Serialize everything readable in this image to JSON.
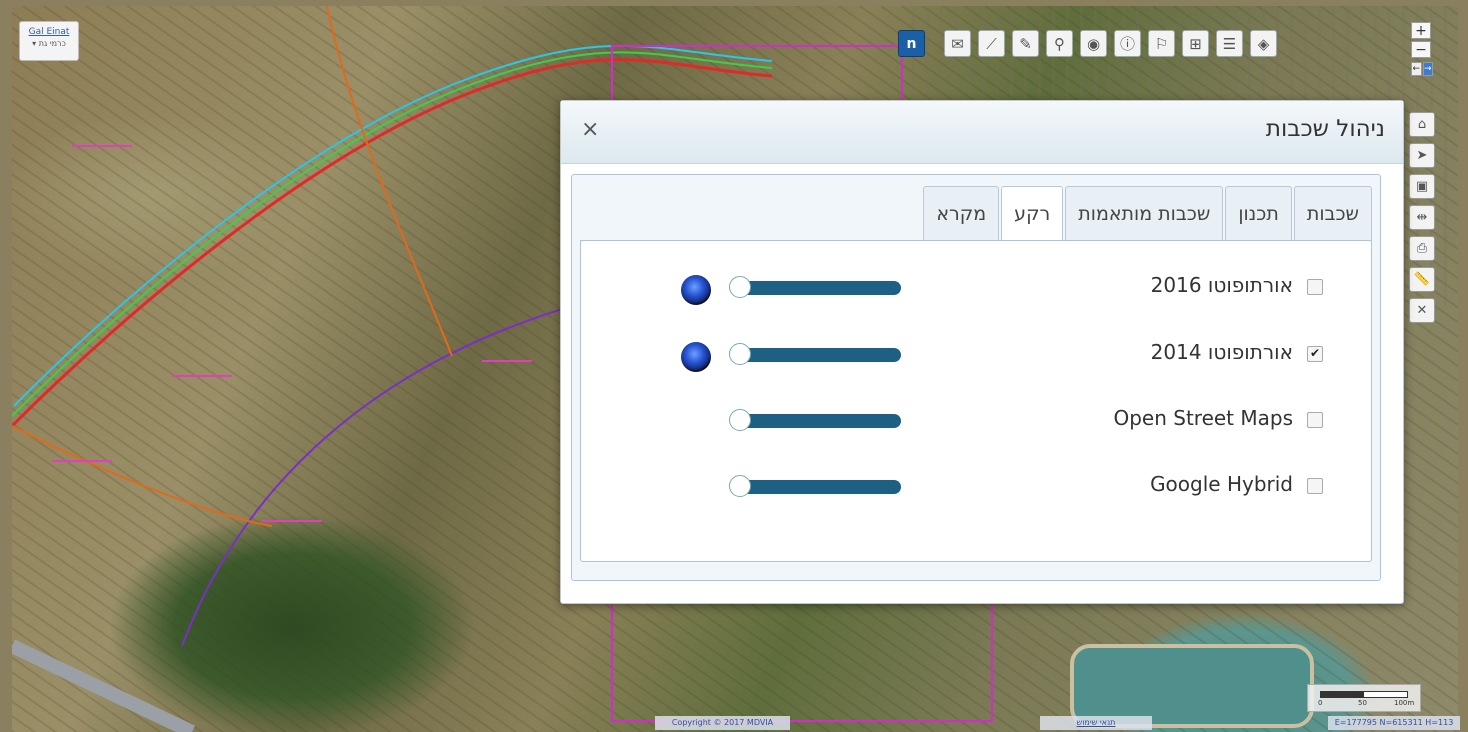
{
  "user": {
    "name": "Gal Einat",
    "menu": "▾ כרמי גת"
  },
  "toolbar": {
    "logo_label": "n",
    "icons": [
      "mail-icon",
      "chart-icon",
      "pencil-icon",
      "search-icon",
      "location-pin-icon",
      "info-icon",
      "flag-icon",
      "sitemap-icon",
      "database-icon",
      "layers-icon"
    ]
  },
  "zoom": {
    "in": "+",
    "out": "−",
    "left": "←",
    "right": "→"
  },
  "side_tools": [
    "home-icon",
    "navigate-icon",
    "bookmark-icon",
    "measure-line-icon",
    "print-icon",
    "ruler-icon",
    "xy-coordinates-icon"
  ],
  "dialog": {
    "title": "ניהול שכבות",
    "close": "×",
    "tabs": [
      {
        "label": "שכבות",
        "active": false
      },
      {
        "label": "תכנון",
        "active": false
      },
      {
        "label": "שכבות מותאמות",
        "active": false
      },
      {
        "label": "רקע",
        "active": true
      },
      {
        "label": "מקרא",
        "active": false
      }
    ],
    "layers": [
      {
        "label": "אורתופוטו 2016",
        "checked": false,
        "opacity_handle": 0,
        "loaded": true
      },
      {
        "label": "אורתופוטו 2014",
        "checked": true,
        "opacity_handle": 0,
        "loaded": true
      },
      {
        "label": "Open Street Maps",
        "checked": false,
        "opacity_handle": 0,
        "loaded": false
      },
      {
        "label": "Google Hybrid",
        "checked": false,
        "opacity_handle": 0,
        "loaded": false
      }
    ]
  },
  "footer": {
    "copyright": "Copyright © 2017 MDVIA",
    "terms": "תנאי שימוש",
    "scale_labels": [
      "0",
      "50",
      "100m"
    ],
    "coords": "E=177795 N=615311 H=113"
  }
}
